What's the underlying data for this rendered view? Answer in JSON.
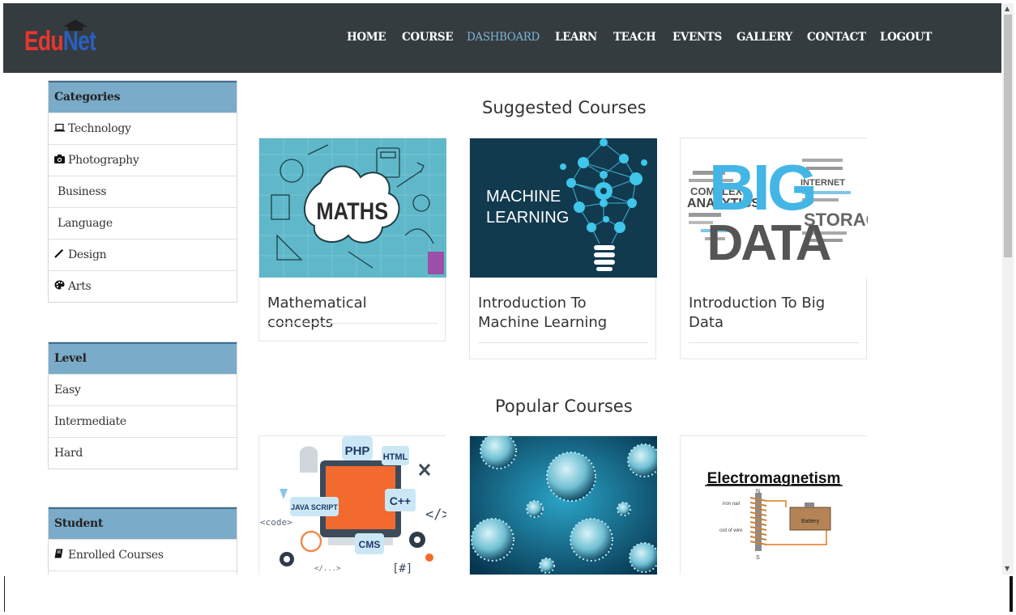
{
  "brand": {
    "part1": "Edu",
    "part2": "Net"
  },
  "nav": {
    "items": [
      "HOME",
      "COURSE",
      "DASHBOARD",
      "LEARN",
      "TEACH",
      "EVENTS",
      "GALLERY",
      "CONTACT",
      "LOGOUT"
    ],
    "active": "DASHBOARD"
  },
  "sidebar": {
    "categories": {
      "title": "Categories",
      "items": [
        {
          "label": "Technology",
          "icon": "laptop-icon"
        },
        {
          "label": "Photography",
          "icon": "camera-icon"
        },
        {
          "label": "Business",
          "icon": ""
        },
        {
          "label": "Language",
          "icon": ""
        },
        {
          "label": "Design",
          "icon": "magic-wand-icon"
        },
        {
          "label": "Arts",
          "icon": "palette-icon"
        }
      ]
    },
    "level": {
      "title": "Level",
      "items": [
        {
          "label": "Easy"
        },
        {
          "label": "Intermediate"
        },
        {
          "label": "Hard"
        }
      ]
    },
    "student": {
      "title": "Student",
      "items": [
        {
          "label": "Enrolled Courses",
          "icon": "book-icon"
        }
      ]
    }
  },
  "suggested": {
    "title": "Suggested Courses",
    "courses": [
      {
        "title": "Mathematical concepts",
        "image_text": "MATHS"
      },
      {
        "title": "Introduction To Machine Learning",
        "image_text_1": "MACHINE",
        "image_text_2": "LEARNING"
      },
      {
        "title": "Introduction To Big Data",
        "image_text_1": "BIG",
        "image_text_2": "DATA"
      }
    ]
  },
  "popular": {
    "title": "Popular Courses",
    "courses": [
      {
        "image_tags": [
          "PHP",
          "HTML",
          "JAVA SCRIPT",
          "C++",
          "CMS",
          "<code>",
          "</>",
          "[#]",
          "</...>"
        ]
      },
      {
        "image": "virus-micrograph"
      },
      {
        "image_text": "Electromagnetism",
        "image_labels": [
          "iron nail",
          "coil of wire",
          "Battery",
          "N",
          "S"
        ]
      }
    ]
  },
  "colors": {
    "navbar": "#343c40",
    "active_link": "#7fb1d3",
    "panel_header": "#7aabc8",
    "brand_red": "#e8352f",
    "brand_blue": "#2a5fbf"
  }
}
